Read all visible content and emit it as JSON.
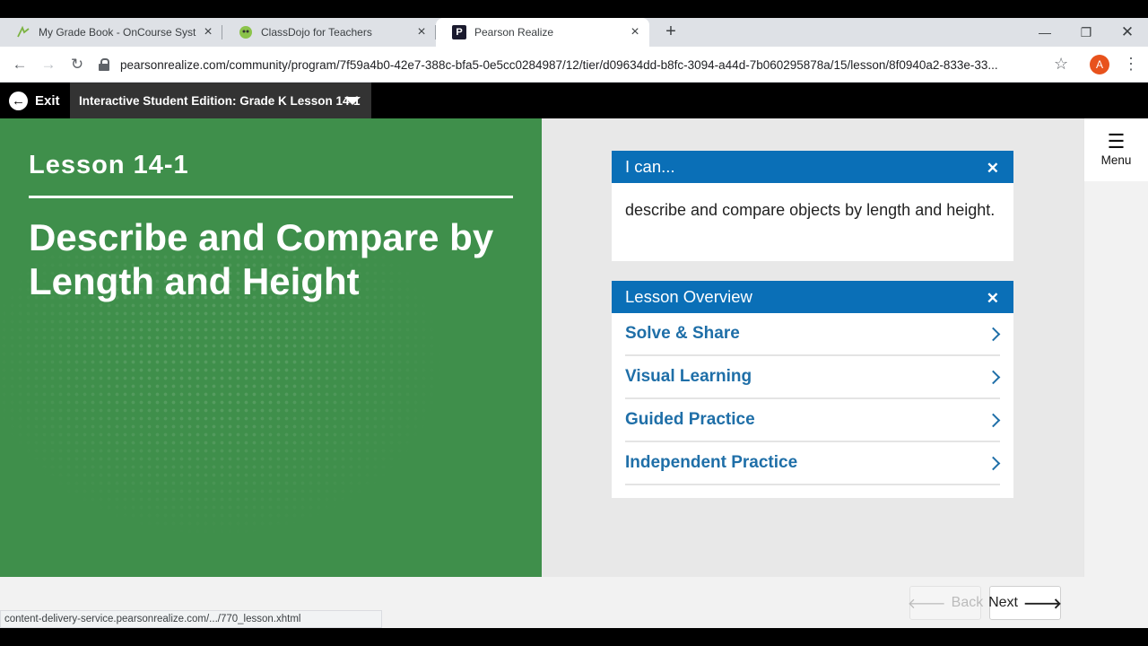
{
  "browser": {
    "tabs": [
      {
        "title": "My Grade Book - OnCourse Syst",
        "icon": "oncourse-favicon",
        "active": false
      },
      {
        "title": "ClassDojo for Teachers",
        "icon": "classdojo-favicon",
        "active": false
      },
      {
        "title": "Pearson Realize",
        "icon": "pearson-favicon",
        "icon_letter": "P",
        "active": true
      }
    ],
    "url": "pearsonrealize.com/community/program/7f59a4b0-42e7-388c-bfa5-0e5cc0284987/12/tier/d09634dd-b8fc-3094-a44d-7b060295878a/15/lesson/8f0940a2-833e-33...",
    "avatar_letter": "A",
    "status_url": "content-delivery-service.pearsonrealize.com/.../770_lesson.xhtml"
  },
  "appbar": {
    "exit_label": "Exit",
    "edition_label": "Interactive Student Edition: Grade K Lesson 14-1"
  },
  "lesson": {
    "number": "Lesson 14-1",
    "title": "Describe and Compare by Length and Height"
  },
  "ican": {
    "heading": "I can...",
    "text": "describe and compare objects by length and height."
  },
  "overview": {
    "heading": "Lesson Overview",
    "items": [
      {
        "label": "Solve & Share"
      },
      {
        "label": "Visual Learning"
      },
      {
        "label": "Guided Practice"
      },
      {
        "label": "Independent Practice"
      }
    ]
  },
  "menu": {
    "label": "Menu"
  },
  "footer": {
    "back_label": "Back",
    "next_label": "Next"
  },
  "colors": {
    "lesson_green": "#3f8f4b",
    "header_blue": "#0a6fb7",
    "link_blue": "#1f6fa8"
  }
}
